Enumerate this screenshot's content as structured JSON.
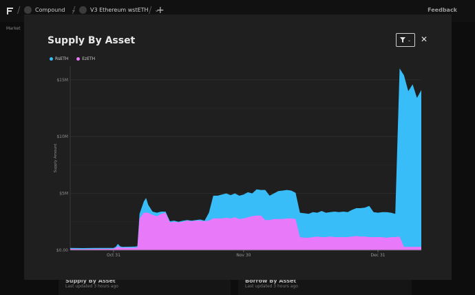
{
  "nav": {
    "crumbs": [
      {
        "label": "Compound"
      },
      {
        "label": "V3 Ethereum wstETH"
      }
    ],
    "feedback": "Feedback",
    "subnav": "Market"
  },
  "modal": {
    "title": "Supply By Asset"
  },
  "bg_cards": [
    {
      "title": "Supply By Asset",
      "subtitle": "Last updated 3 hours ago"
    },
    {
      "title": "Borrow By Asset",
      "subtitle": "Last updated 3 hours ago"
    }
  ],
  "colors": {
    "rseth": "#38bdf8",
    "ezeth": "#e879f9"
  },
  "chart_data": {
    "type": "area",
    "stacked": true,
    "ylabel": "Supply Amount",
    "ylim": [
      0,
      16.2
    ],
    "yticks": [
      {
        "v": 0,
        "label": "$0.00"
      },
      {
        "v": 5,
        "label": "$5M"
      },
      {
        "v": 10,
        "label": "$10M"
      },
      {
        "v": 15,
        "label": "$15M"
      }
    ],
    "xlim": [
      0,
      81
    ],
    "xticks": [
      {
        "v": 10,
        "label": "Oct 31"
      },
      {
        "v": 40,
        "label": "Nov 30"
      },
      {
        "v": 71,
        "label": "Dec 31"
      }
    ],
    "legend_position": "top-left",
    "series": [
      {
        "name": "EzETH",
        "color": "#e879f9",
        "points": [
          [
            0,
            0.12
          ],
          [
            3,
            0.1
          ],
          [
            6,
            0.12
          ],
          [
            9,
            0.12
          ],
          [
            10,
            0.12
          ],
          [
            10.5,
            0.2
          ],
          [
            11,
            0.35
          ],
          [
            11.5,
            0.25
          ],
          [
            12,
            0.22
          ],
          [
            15,
            0.22
          ],
          [
            15.5,
            0.25
          ],
          [
            16,
            2.8
          ],
          [
            17,
            3.3
          ],
          [
            18,
            3.3
          ],
          [
            19,
            3.1
          ],
          [
            20,
            3.0
          ],
          [
            21,
            3.2
          ],
          [
            22,
            3.3
          ],
          [
            23,
            2.45
          ],
          [
            24,
            2.5
          ],
          [
            25,
            2.45
          ],
          [
            26,
            2.5
          ],
          [
            27,
            2.6
          ],
          [
            28,
            2.55
          ],
          [
            29,
            2.6
          ],
          [
            30,
            2.6
          ],
          [
            31,
            2.55
          ],
          [
            32,
            2.6
          ],
          [
            33,
            2.8
          ],
          [
            34,
            2.8
          ],
          [
            35,
            2.8
          ],
          [
            36,
            2.85
          ],
          [
            37,
            2.8
          ],
          [
            38,
            2.9
          ],
          [
            39,
            2.75
          ],
          [
            40,
            2.8
          ],
          [
            41,
            2.9
          ],
          [
            42,
            3.0
          ],
          [
            43,
            3.05
          ],
          [
            44,
            3.05
          ],
          [
            45,
            2.65
          ],
          [
            46,
            2.65
          ],
          [
            47,
            2.75
          ],
          [
            48,
            2.75
          ],
          [
            49,
            2.75
          ],
          [
            50,
            2.8
          ],
          [
            51,
            2.8
          ],
          [
            52,
            2.75
          ],
          [
            53,
            1.15
          ],
          [
            54,
            1.1
          ],
          [
            55,
            1.1
          ],
          [
            56,
            1.15
          ],
          [
            57,
            1.2
          ],
          [
            58,
            1.15
          ],
          [
            59,
            1.15
          ],
          [
            60,
            1.2
          ],
          [
            61,
            1.15
          ],
          [
            62,
            1.15
          ],
          [
            63,
            1.15
          ],
          [
            64,
            1.15
          ],
          [
            65,
            1.2
          ],
          [
            66,
            1.25
          ],
          [
            67,
            1.2
          ],
          [
            68,
            1.2
          ],
          [
            69,
            1.15
          ],
          [
            70,
            1.15
          ],
          [
            71,
            1.15
          ],
          [
            72,
            1.15
          ],
          [
            73,
            1.1
          ],
          [
            74,
            1.15
          ],
          [
            75,
            1.15
          ],
          [
            76,
            1.2
          ],
          [
            77,
            0.3
          ],
          [
            78,
            0.3
          ],
          [
            79,
            0.3
          ],
          [
            80,
            0.3
          ],
          [
            81,
            0.3
          ]
        ]
      },
      {
        "name": "RsETH",
        "color": "#38bdf8",
        "points": [
          [
            0,
            0.2
          ],
          [
            3,
            0.18
          ],
          [
            6,
            0.2
          ],
          [
            9,
            0.2
          ],
          [
            10,
            0.2
          ],
          [
            10.5,
            0.3
          ],
          [
            11,
            0.55
          ],
          [
            11.5,
            0.35
          ],
          [
            12,
            0.3
          ],
          [
            15,
            0.32
          ],
          [
            15.5,
            0.35
          ],
          [
            16,
            3.2
          ],
          [
            17,
            4.3
          ],
          [
            17.5,
            4.6
          ],
          [
            18,
            4.0
          ],
          [
            19,
            3.4
          ],
          [
            20,
            3.3
          ],
          [
            21,
            3.4
          ],
          [
            22,
            3.4
          ],
          [
            23,
            2.55
          ],
          [
            24,
            2.6
          ],
          [
            25,
            2.5
          ],
          [
            26,
            2.6
          ],
          [
            27,
            2.65
          ],
          [
            28,
            2.6
          ],
          [
            29,
            2.65
          ],
          [
            30,
            2.7
          ],
          [
            31,
            2.6
          ],
          [
            32,
            3.3
          ],
          [
            33,
            4.8
          ],
          [
            34,
            4.8
          ],
          [
            35,
            4.9
          ],
          [
            36,
            5.0
          ],
          [
            37,
            4.85
          ],
          [
            38,
            5.0
          ],
          [
            39,
            4.8
          ],
          [
            40,
            4.9
          ],
          [
            41,
            5.1
          ],
          [
            42,
            5.0
          ],
          [
            43,
            5.35
          ],
          [
            44,
            5.3
          ],
          [
            45,
            5.3
          ],
          [
            46,
            4.8
          ],
          [
            47,
            5.0
          ],
          [
            48,
            5.2
          ],
          [
            49,
            5.25
          ],
          [
            50,
            5.3
          ],
          [
            51,
            5.25
          ],
          [
            52,
            5.05
          ],
          [
            53,
            3.3
          ],
          [
            54,
            3.25
          ],
          [
            55,
            3.2
          ],
          [
            56,
            3.35
          ],
          [
            57,
            3.3
          ],
          [
            58,
            3.45
          ],
          [
            59,
            3.3
          ],
          [
            60,
            3.35
          ],
          [
            61,
            3.4
          ],
          [
            62,
            3.35
          ],
          [
            63,
            3.4
          ],
          [
            64,
            3.35
          ],
          [
            65,
            3.55
          ],
          [
            66,
            3.7
          ],
          [
            67,
            3.7
          ],
          [
            68,
            3.75
          ],
          [
            69,
            3.9
          ],
          [
            70,
            3.35
          ],
          [
            71,
            3.3
          ],
          [
            72,
            3.35
          ],
          [
            73,
            3.35
          ],
          [
            74,
            3.3
          ],
          [
            75,
            3.2
          ],
          [
            76,
            16.0
          ],
          [
            77,
            15.4
          ],
          [
            78,
            14.0
          ],
          [
            79,
            14.6
          ],
          [
            80,
            13.4
          ],
          [
            81,
            14.1
          ]
        ]
      }
    ]
  }
}
